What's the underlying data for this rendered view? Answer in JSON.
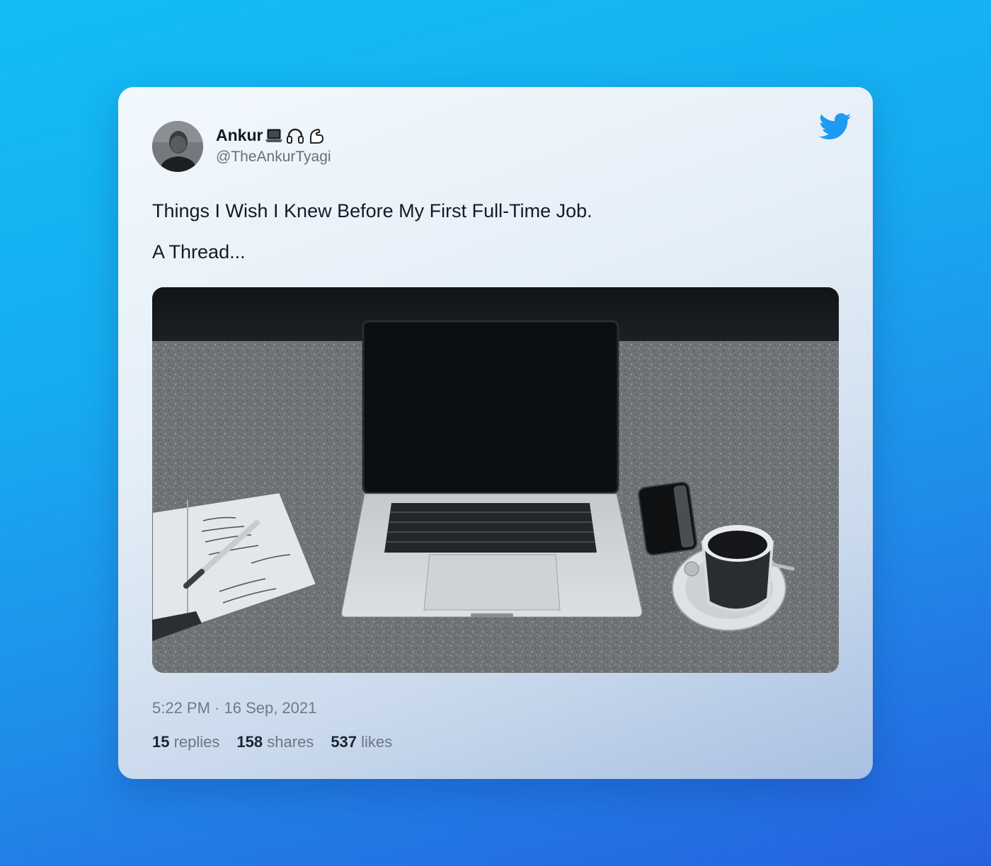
{
  "tweet": {
    "author_name": "Ankur",
    "author_emojis": [
      "laptop-emoji",
      "headphones-emoji",
      "flexed-biceps-emoji"
    ],
    "handle": "@TheAnkurTyagi",
    "text_line1": "Things I Wish I Knew Before My First Full-Time Job.",
    "text_line2": "A Thread...",
    "timestamp": "5:22 PM · 16 Sep, 2021",
    "stats": {
      "replies_count": "15",
      "replies_label": "replies",
      "shares_count": "158",
      "shares_label": "shares",
      "likes_count": "537",
      "likes_label": "likes"
    }
  },
  "icons": {
    "brand": "twitter-bird-icon"
  },
  "colors": {
    "background_top": "#12bdf5",
    "background_bottom": "#2661e0",
    "twitter_blue": "#1d9bf0",
    "text_primary": "#121c26",
    "text_secondary": "#707a86"
  }
}
